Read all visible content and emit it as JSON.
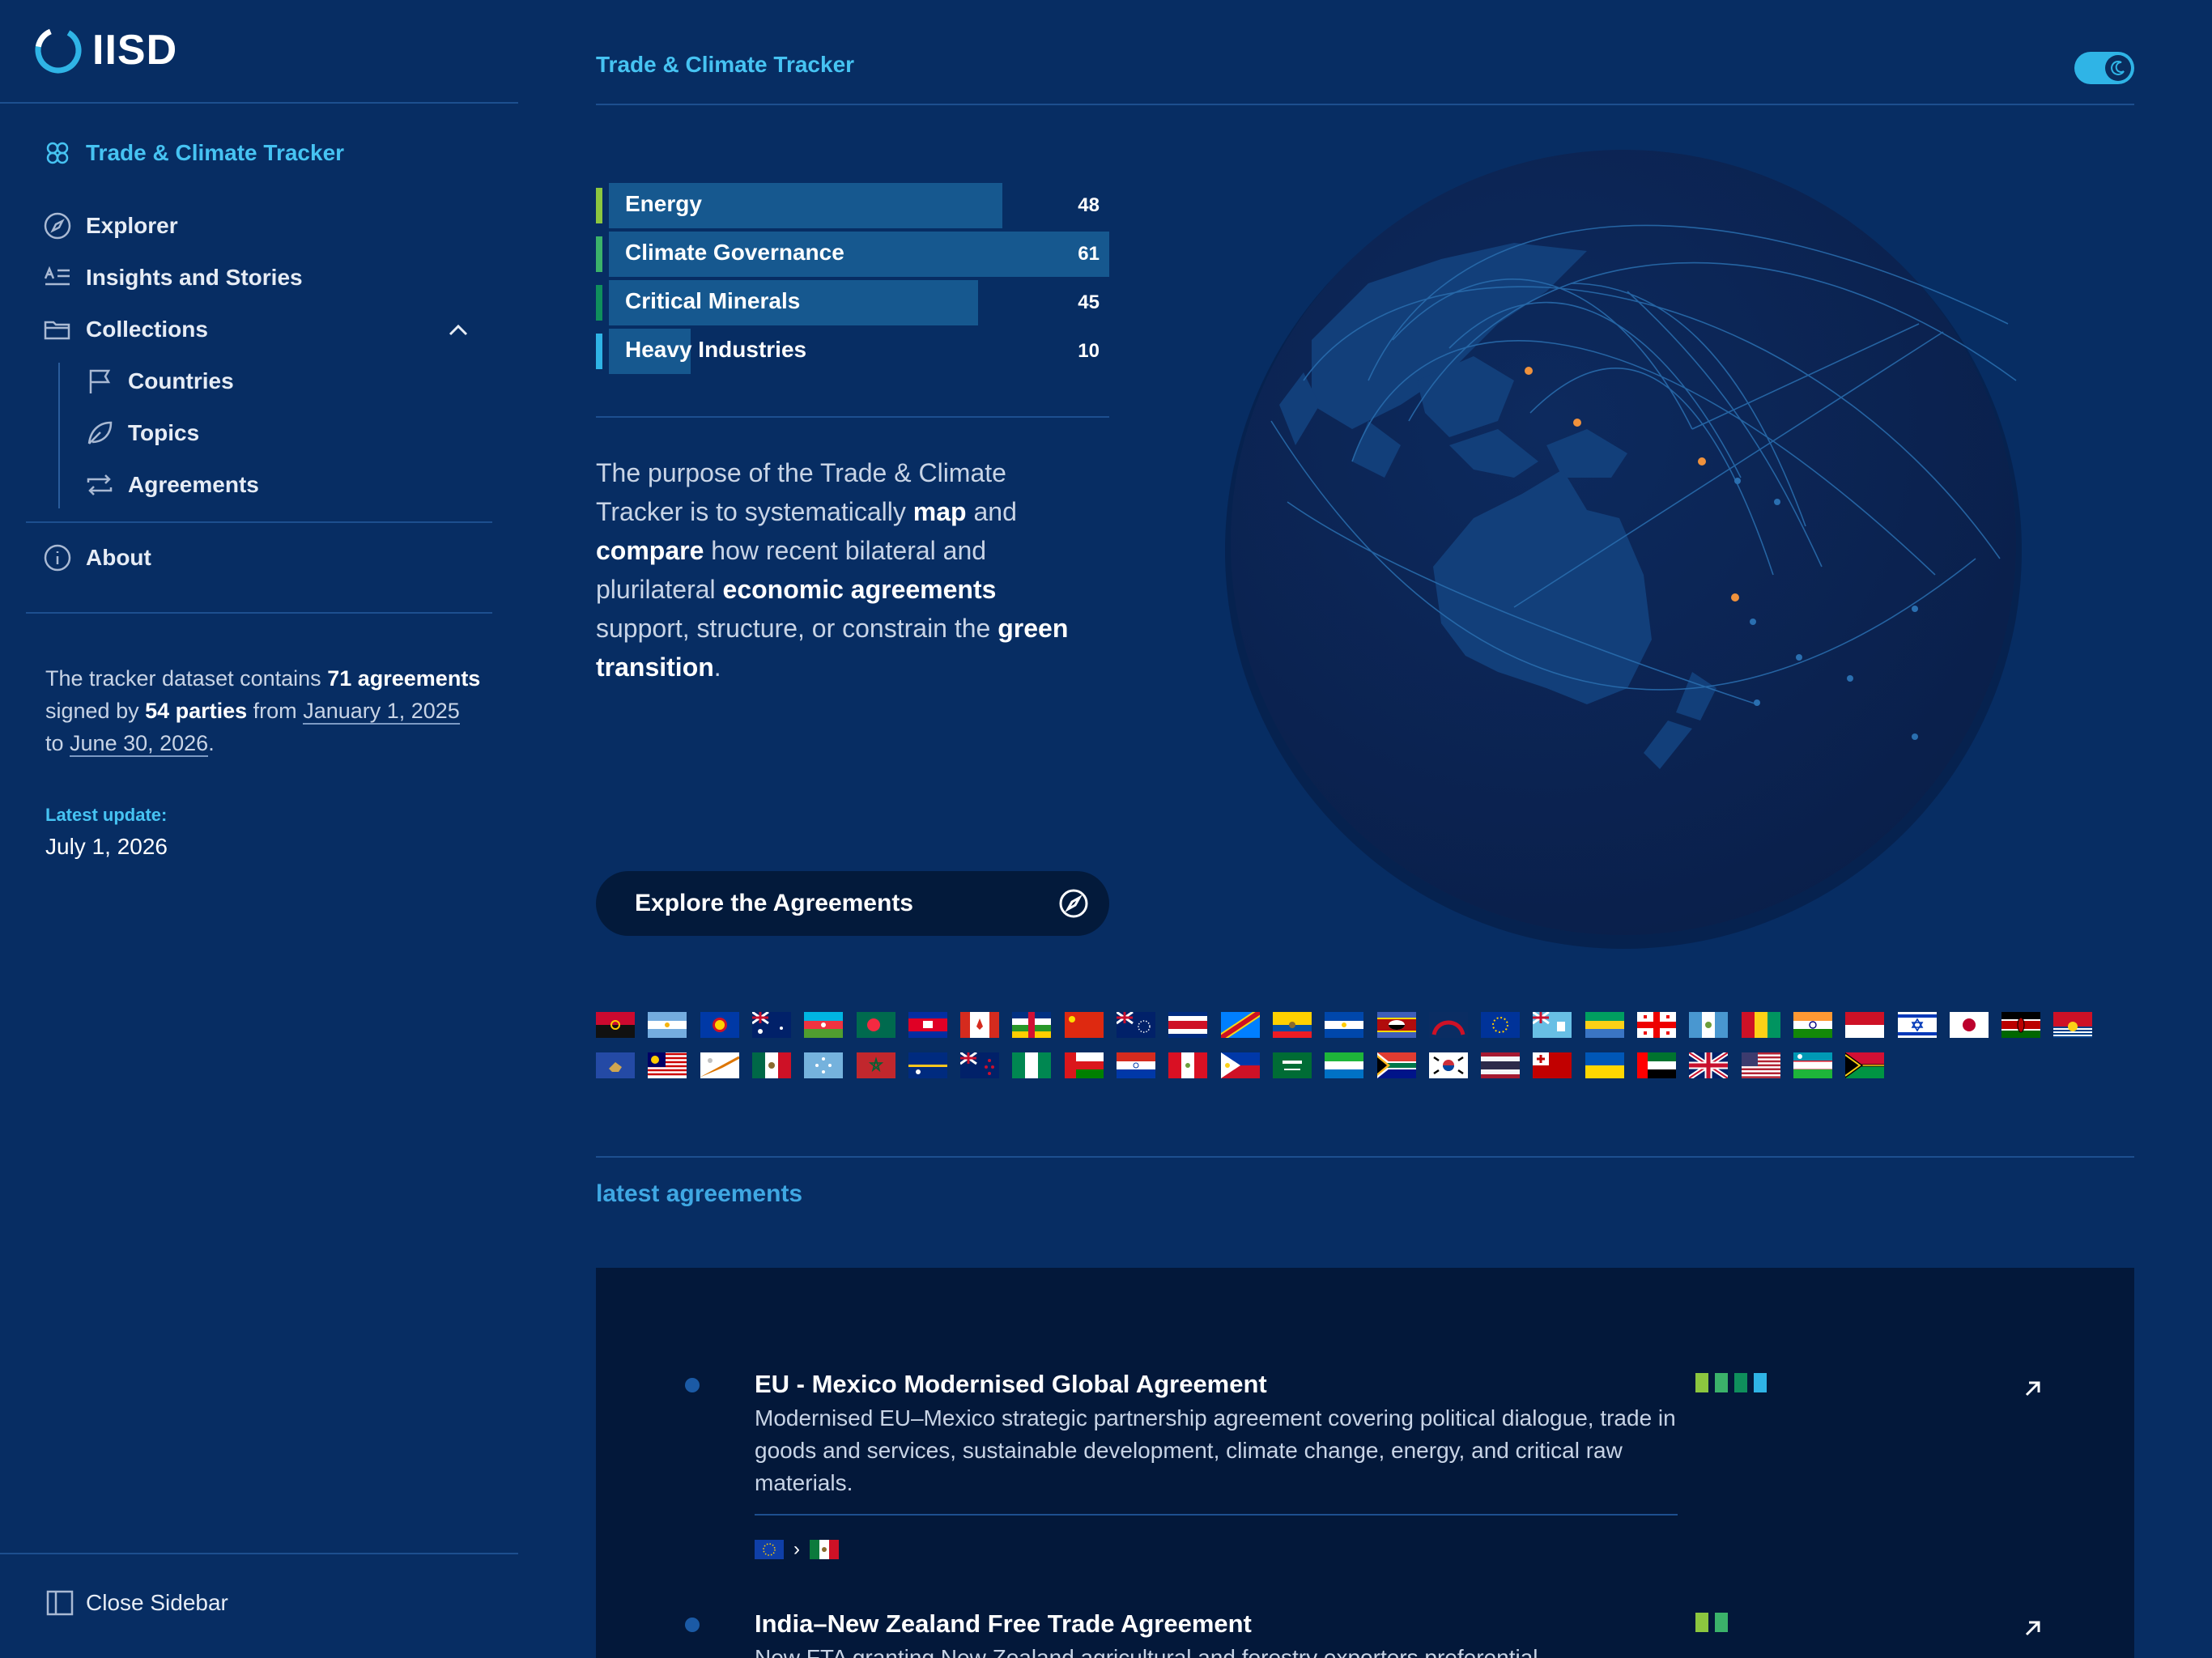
{
  "brand": {
    "logo_text": "IISD"
  },
  "sidebar": {
    "app_link": "Trade & Climate Tracker",
    "items": [
      {
        "label": "Explorer"
      },
      {
        "label": "Insights and Stories"
      },
      {
        "label": "Collections"
      },
      {
        "label": "Countries"
      },
      {
        "label": "Topics"
      },
      {
        "label": "Agreements"
      },
      {
        "label": "About"
      }
    ],
    "summary": {
      "p1": "The tracker dataset contains ",
      "agreements_count": "71",
      "agreements_word": "agreements",
      "p2": " signed by ",
      "parties": "54 parties",
      "p3": " from ",
      "start_date": "January 1, 2025",
      "p4": " to ",
      "end_date": "June 30, 2026",
      "p5": "."
    },
    "latest_update_label": "Latest update:",
    "latest_update_date": "July 1, 2026",
    "close_label": "Close Sidebar"
  },
  "header": {
    "title": "Trade & Climate Tracker"
  },
  "topics": [
    {
      "label": "Energy",
      "value": 48,
      "color": "#8cc63f"
    },
    {
      "label": "Climate Governance",
      "value": 61,
      "color": "#3bb26a"
    },
    {
      "label": "Critical Minerals",
      "value": 45,
      "color": "#0f8f5c"
    },
    {
      "label": "Heavy Industries",
      "value": 10,
      "color": "#2fb4e6"
    }
  ],
  "topics_max": 61,
  "purpose": {
    "t1": "The purpose of the Trade & Climate Tracker is to systematically ",
    "b1": "map",
    "t2": " and ",
    "b2": "compare",
    "t3": " how recent bilateral and plurilateral ",
    "b3": "economic agreements",
    "t4": " support, structure, or constrain the ",
    "b4": "green transition",
    "t5": "."
  },
  "explore_button": "Explore the Agreements",
  "latest_agreements_title": "latest agreements",
  "agreements": [
    {
      "title": "EU - Mexico Modernised Global Agreement",
      "description": "Modernised EU–Mexico strategic partnership agreement covering political dialogue, trade in goods and services, sustainable development, climate change, energy, and critical raw materials.",
      "tags": [
        "#8cc63f",
        "#3bb26a",
        "#0f8f5c",
        "#2fb4e6"
      ],
      "flags": [
        "eu",
        "mx"
      ]
    },
    {
      "title": "India–New Zealand Free Trade Agreement",
      "description": "New FTA granting New Zealand agricultural and forestry exporters preferential",
      "tags": [
        "#8cc63f",
        "#3bb26a"
      ],
      "flags": []
    }
  ],
  "flag_rows": [
    [
      "ao",
      "ar",
      "asean",
      "au",
      "az",
      "bd",
      "kh",
      "ca",
      "cf",
      "cn",
      "ck",
      "cr",
      "cd",
      "ec",
      "sv",
      "sz",
      "fj2",
      "eu",
      "fj",
      "ga",
      "ge",
      "gt",
      "gn",
      "in",
      "id",
      "il",
      "jp",
      "ke",
      "ki"
    ],
    [
      "xk",
      "my",
      "mh",
      "mx",
      "fm",
      "ma",
      "nr",
      "nz",
      "ng",
      "om",
      "py",
      "pe",
      "ph",
      "sa",
      "sl",
      "za",
      "kr",
      "th",
      "to",
      "ua",
      "ae",
      "gb",
      "us",
      "uz",
      "vu"
    ]
  ]
}
